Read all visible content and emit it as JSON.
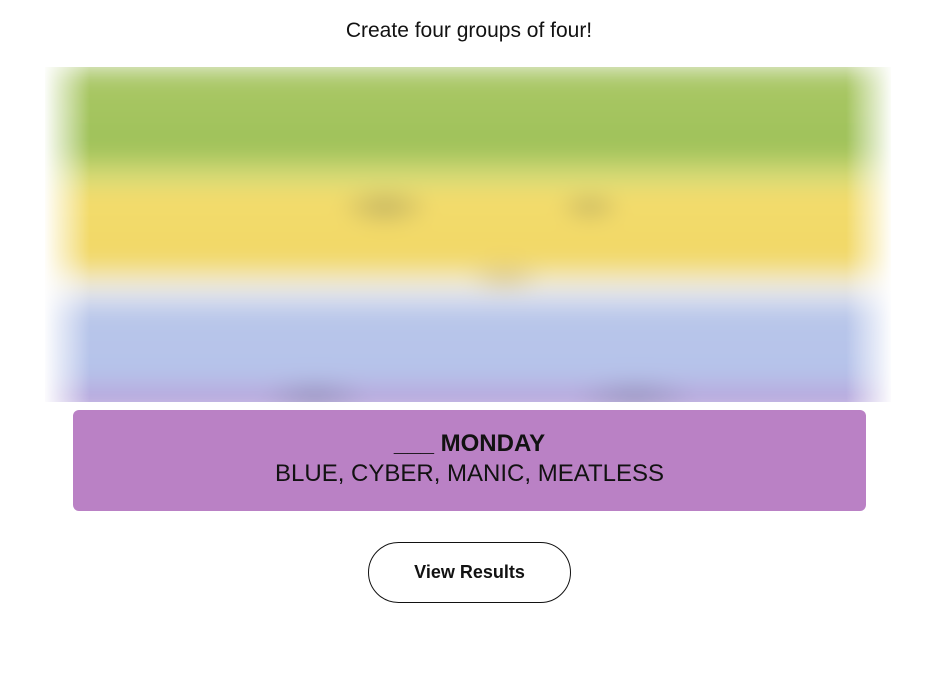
{
  "instructions": "Create four groups of four!",
  "board": {
    "state": "blurred",
    "row_colors": [
      "#a0c35a",
      "#f9df6d",
      "#b0c4ef",
      "#ba81c5"
    ]
  },
  "solved_group": {
    "title": "___ MONDAY",
    "members": "BLUE, CYBER, MANIC, MEATLESS",
    "color": "#ba81c5"
  },
  "actions": {
    "view_results_label": "View Results"
  }
}
